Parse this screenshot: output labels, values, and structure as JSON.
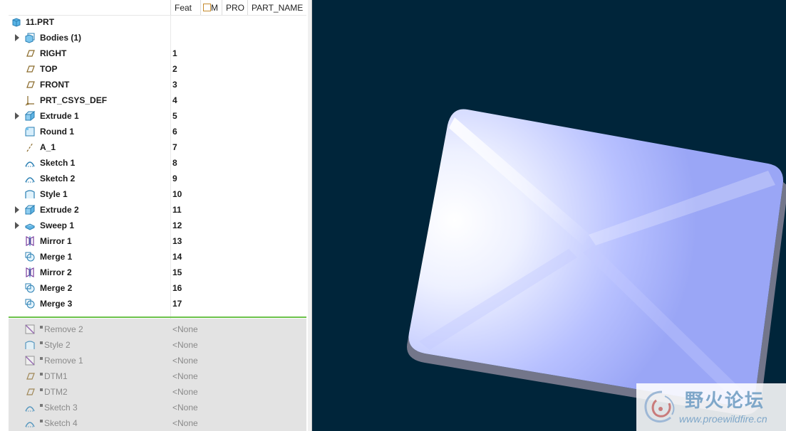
{
  "model_tree": {
    "columns": {
      "name": "",
      "feat": "Feat",
      "m": "M",
      "pro": "PRO",
      "part_name": "PART_NAME"
    },
    "root": {
      "label": "11.PRT",
      "icon": "part-icon"
    },
    "features": [
      {
        "label": "Bodies (1)",
        "num": "",
        "icon": "bodies-icon",
        "expandable": true
      },
      {
        "label": "RIGHT",
        "num": "1",
        "icon": "datum-plane-icon",
        "expandable": false
      },
      {
        "label": "TOP",
        "num": "2",
        "icon": "datum-plane-icon",
        "expandable": false
      },
      {
        "label": "FRONT",
        "num": "3",
        "icon": "datum-plane-icon",
        "expandable": false
      },
      {
        "label": "PRT_CSYS_DEF",
        "num": "4",
        "icon": "csys-icon",
        "expandable": false
      },
      {
        "label": "Extrude 1",
        "num": "5",
        "icon": "extrude-icon",
        "expandable": true
      },
      {
        "label": "Round 1",
        "num": "6",
        "icon": "round-icon",
        "expandable": false
      },
      {
        "label": "A_1",
        "num": "7",
        "icon": "datum-axis-icon",
        "expandable": false
      },
      {
        "label": "Sketch 1",
        "num": "8",
        "icon": "sketch-icon",
        "expandable": false
      },
      {
        "label": "Sketch 2",
        "num": "9",
        "icon": "sketch-icon",
        "expandable": false
      },
      {
        "label": "Style 1",
        "num": "10",
        "icon": "style-icon",
        "expandable": false
      },
      {
        "label": "Extrude 2",
        "num": "11",
        "icon": "extrude-icon",
        "expandable": true
      },
      {
        "label": "Sweep 1",
        "num": "12",
        "icon": "sweep-icon",
        "expandable": true
      },
      {
        "label": "Mirror 1",
        "num": "13",
        "icon": "mirror-icon",
        "expandable": false
      },
      {
        "label": "Merge 1",
        "num": "14",
        "icon": "merge-icon",
        "expandable": false
      },
      {
        "label": "Mirror 2",
        "num": "15",
        "icon": "mirror-icon",
        "expandable": false
      },
      {
        "label": "Merge 2",
        "num": "16",
        "icon": "merge-icon",
        "expandable": false
      },
      {
        "label": "Merge 3",
        "num": "17",
        "icon": "merge-icon",
        "expandable": false
      }
    ],
    "suppressed": [
      {
        "label": "Remove 2",
        "num": "<None>",
        "icon": "remove-icon"
      },
      {
        "label": "Style 2",
        "num": "<None>",
        "icon": "style-icon"
      },
      {
        "label": "Remove 1",
        "num": "<None>",
        "icon": "remove-icon"
      },
      {
        "label": "DTM1",
        "num": "<None>",
        "icon": "datum-plane-icon"
      },
      {
        "label": "DTM2",
        "num": "<None>",
        "icon": "datum-plane-icon"
      },
      {
        "label": "Sketch 3",
        "num": "<None>",
        "icon": "sketch-icon"
      },
      {
        "label": "Sketch 4",
        "num": "<None>",
        "icon": "sketch-icon"
      }
    ]
  },
  "viewport": {
    "background": "#00253a",
    "model_color": "#aab4ff",
    "model_edge_color": "#7a7d8f"
  },
  "watermark": {
    "title": "野火论坛",
    "url": "www.proewildfire.cn"
  }
}
